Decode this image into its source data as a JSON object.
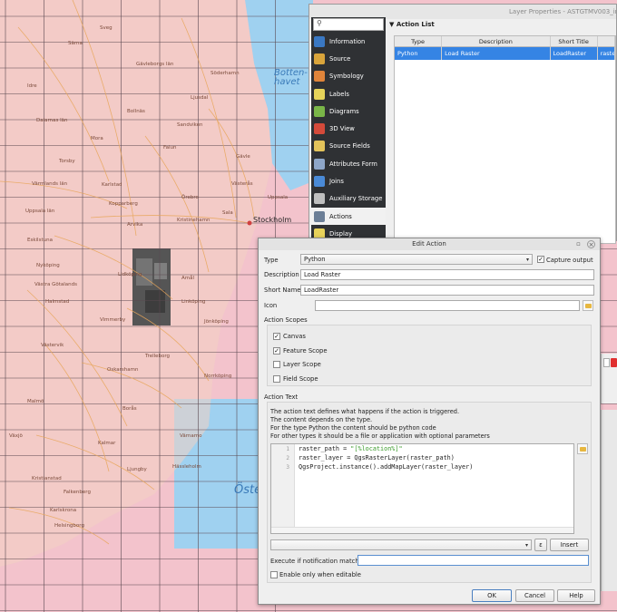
{
  "map": {
    "sea_labels": [
      "Botten-\nhavet",
      "Öste"
    ],
    "city_label": "Stockholm",
    "places": [
      "Sveg",
      "Särna",
      "Gävleborgs län",
      "Söderhamn",
      "Idre",
      "Dalarnas län",
      "Bollnäs",
      "Ljusdal",
      "Torsby",
      "Mora",
      "Falun",
      "Sandviken",
      "Gävle",
      "Värmlands län",
      "Karlstad",
      "Kopparberg",
      "Örebro",
      "Västerås",
      "Uppsala",
      "Uppsala län",
      "Arvika",
      "Kristinehamn",
      "Sala",
      "Eskilstuna",
      "Nyköping",
      "Amål",
      "Västra Götalands",
      "Linköping",
      "Jönköping",
      "Norrköping",
      "Västervik",
      "Oskarshamn",
      "Borås",
      "Värnamo",
      "Växjö",
      "Kalmar",
      "Falkenberg",
      "Ljungby",
      "Hässleholm",
      "Kristianstad",
      "Karlskrona",
      "Helsingborg",
      "Malmö",
      "Trelleborg",
      "Halmstad",
      "Vimmerby",
      "Lidköping",
      "Motala",
      "Skövde"
    ]
  },
  "layer_properties": {
    "title": "Layer Properties - ASTGTMV003_index",
    "search_placeholder": "",
    "sidebar": [
      {
        "label": "Information",
        "icon": "info-icon",
        "color": "#3a78c3"
      },
      {
        "label": "Source",
        "icon": "source-icon",
        "color": "#d9a43b"
      },
      {
        "label": "Symbology",
        "icon": "symbology-icon",
        "color": "#e0843a"
      },
      {
        "label": "Labels",
        "icon": "labels-icon",
        "color": "#e6d45a"
      },
      {
        "label": "Diagrams",
        "icon": "diagrams-icon",
        "color": "#7ab648"
      },
      {
        "label": "3D View",
        "icon": "cube-icon",
        "color": "#d44a3a"
      },
      {
        "label": "Source Fields",
        "icon": "fields-icon",
        "color": "#e3c35a"
      },
      {
        "label": "Attributes Form",
        "icon": "form-icon",
        "color": "#8ea6c8"
      },
      {
        "label": "Joins",
        "icon": "joins-icon",
        "color": "#4a8ad6"
      },
      {
        "label": "Auxiliary Storage",
        "icon": "storage-icon",
        "color": "#bfbfbf"
      },
      {
        "label": "Actions",
        "icon": "gear-icon",
        "color": "#6b7e96"
      },
      {
        "label": "Display",
        "icon": "display-icon",
        "color": "#e8d25a"
      }
    ],
    "active_item": "Actions",
    "action_list": {
      "header": "Action List",
      "columns": [
        "Type",
        "Description",
        "Short Title",
        ""
      ],
      "rows": [
        {
          "type": "Python",
          "description": "Load Raster",
          "short_title": "LoadRaster",
          "extra": "raste"
        }
      ]
    }
  },
  "edit_action": {
    "title": "Edit Action",
    "type_label": "Type",
    "type_value": "Python",
    "capture_output_label": "Capture output",
    "capture_output_checked": true,
    "description_label": "Description",
    "description_value": "Load Raster",
    "short_name_label": "Short Name",
    "short_name_value": "LoadRaster",
    "icon_label": "Icon",
    "icon_value": "",
    "scopes_label": "Action Scopes",
    "scopes": [
      {
        "label": "Canvas",
        "checked": true
      },
      {
        "label": "Feature Scope",
        "checked": true
      },
      {
        "label": "Layer Scope",
        "checked": false
      },
      {
        "label": "Field Scope",
        "checked": false
      }
    ],
    "action_text_label": "Action Text",
    "description_lines": [
      "The action text defines what happens if the action is triggered.",
      "The content depends on the type.",
      "For the type Python the content should be python code",
      "For other types it should be a file or application with optional parameters"
    ],
    "code": {
      "line_numbers": [
        "1",
        "2",
        "3"
      ],
      "line1_prefix": "raster_path = ",
      "line1_string": "\"[%location%]\"",
      "line2": "raster_layer = QgsRasterLayer(raster_path)",
      "line3": "QgsProject.instance().addMapLayer(raster_layer)"
    },
    "expression_value": "",
    "epsilon_label": "ε",
    "insert_label": "Insert",
    "notification_label": "Execute if notification matches",
    "notification_value": "",
    "editable_label": "Enable only when editable",
    "editable_checked": false,
    "ok_label": "OK",
    "cancel_label": "Cancel",
    "help_label": "Help"
  }
}
